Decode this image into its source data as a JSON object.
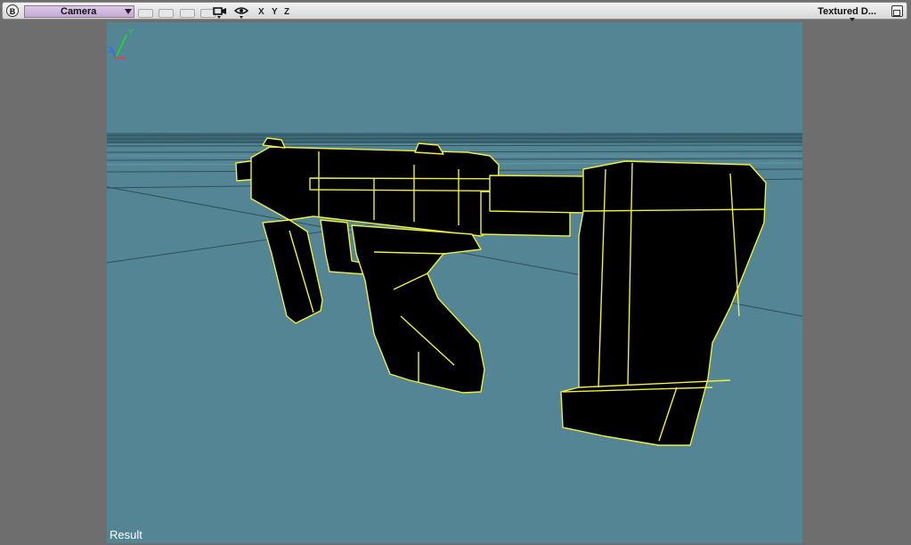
{
  "toolbar": {
    "panel_button": "B",
    "camera_select": "Camera",
    "axis_x": "X",
    "axis_y": "Y",
    "axis_z": "Z",
    "shading_mode": "Textured D..."
  },
  "viewport": {
    "label": "Result",
    "gizmo_y": "Y",
    "gizmo_z": "Z",
    "background_color": "#538594",
    "wire_color": "#f2ef3a"
  },
  "icons": [
    "camera-icon",
    "eye-icon",
    "maximize-icon",
    "chevron-down-icon"
  ]
}
